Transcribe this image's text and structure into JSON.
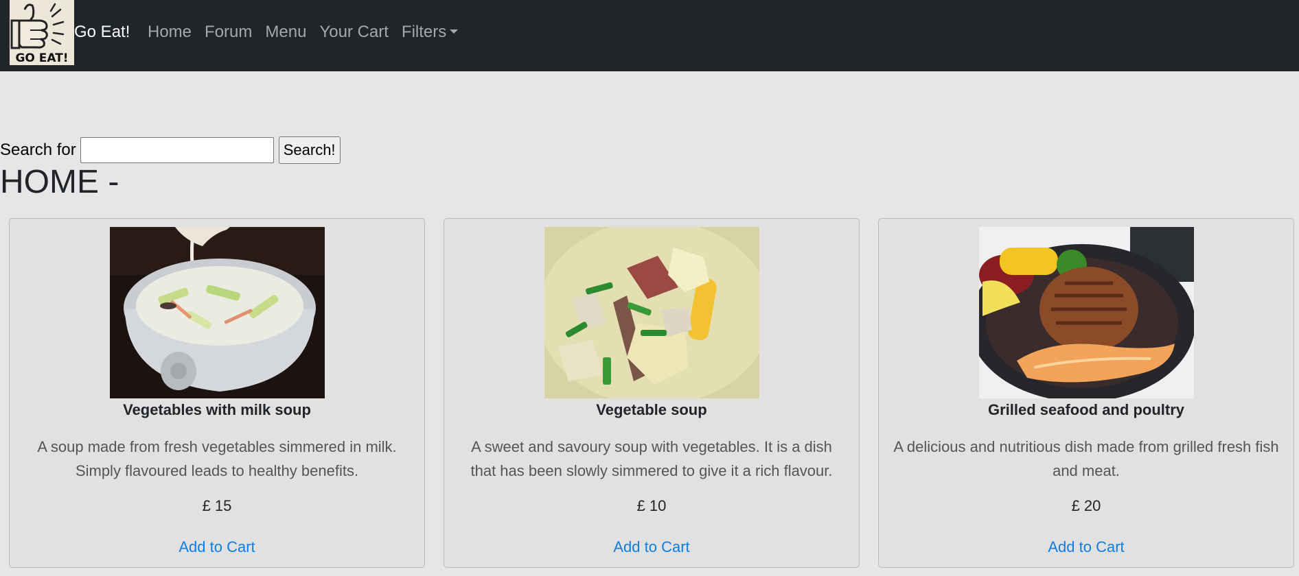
{
  "nav": {
    "logo_text": "GO EAT!",
    "brand": "Go Eat!",
    "links": [
      "Home",
      "Forum",
      "Menu",
      "Your Cart"
    ],
    "filters": "Filters"
  },
  "search": {
    "label": "Search for",
    "value": "",
    "button": "Search!"
  },
  "page": {
    "title": "HOME -"
  },
  "products": [
    {
      "name": "Vegetables with milk soup",
      "description": "A soup made from fresh vegetables simmered in milk. Simply flavoured leads to healthy benefits.",
      "price": "£ 15",
      "action": "Add to Cart"
    },
    {
      "name": "Vegetable soup",
      "description": "A sweet and savoury soup with vegetables. It is a dish that has been slowly simmered to give it a rich flavour.",
      "price": "£ 10",
      "action": "Add to Cart"
    },
    {
      "name": "Grilled seafood and poultry",
      "description": "A delicious and nutritious dish made from grilled fresh fish and meat.",
      "price": "£ 20",
      "action": "Add to Cart"
    }
  ],
  "colors": {
    "navbar": "#212529",
    "background": "#e6e6e6",
    "link": "#0d7de8"
  }
}
